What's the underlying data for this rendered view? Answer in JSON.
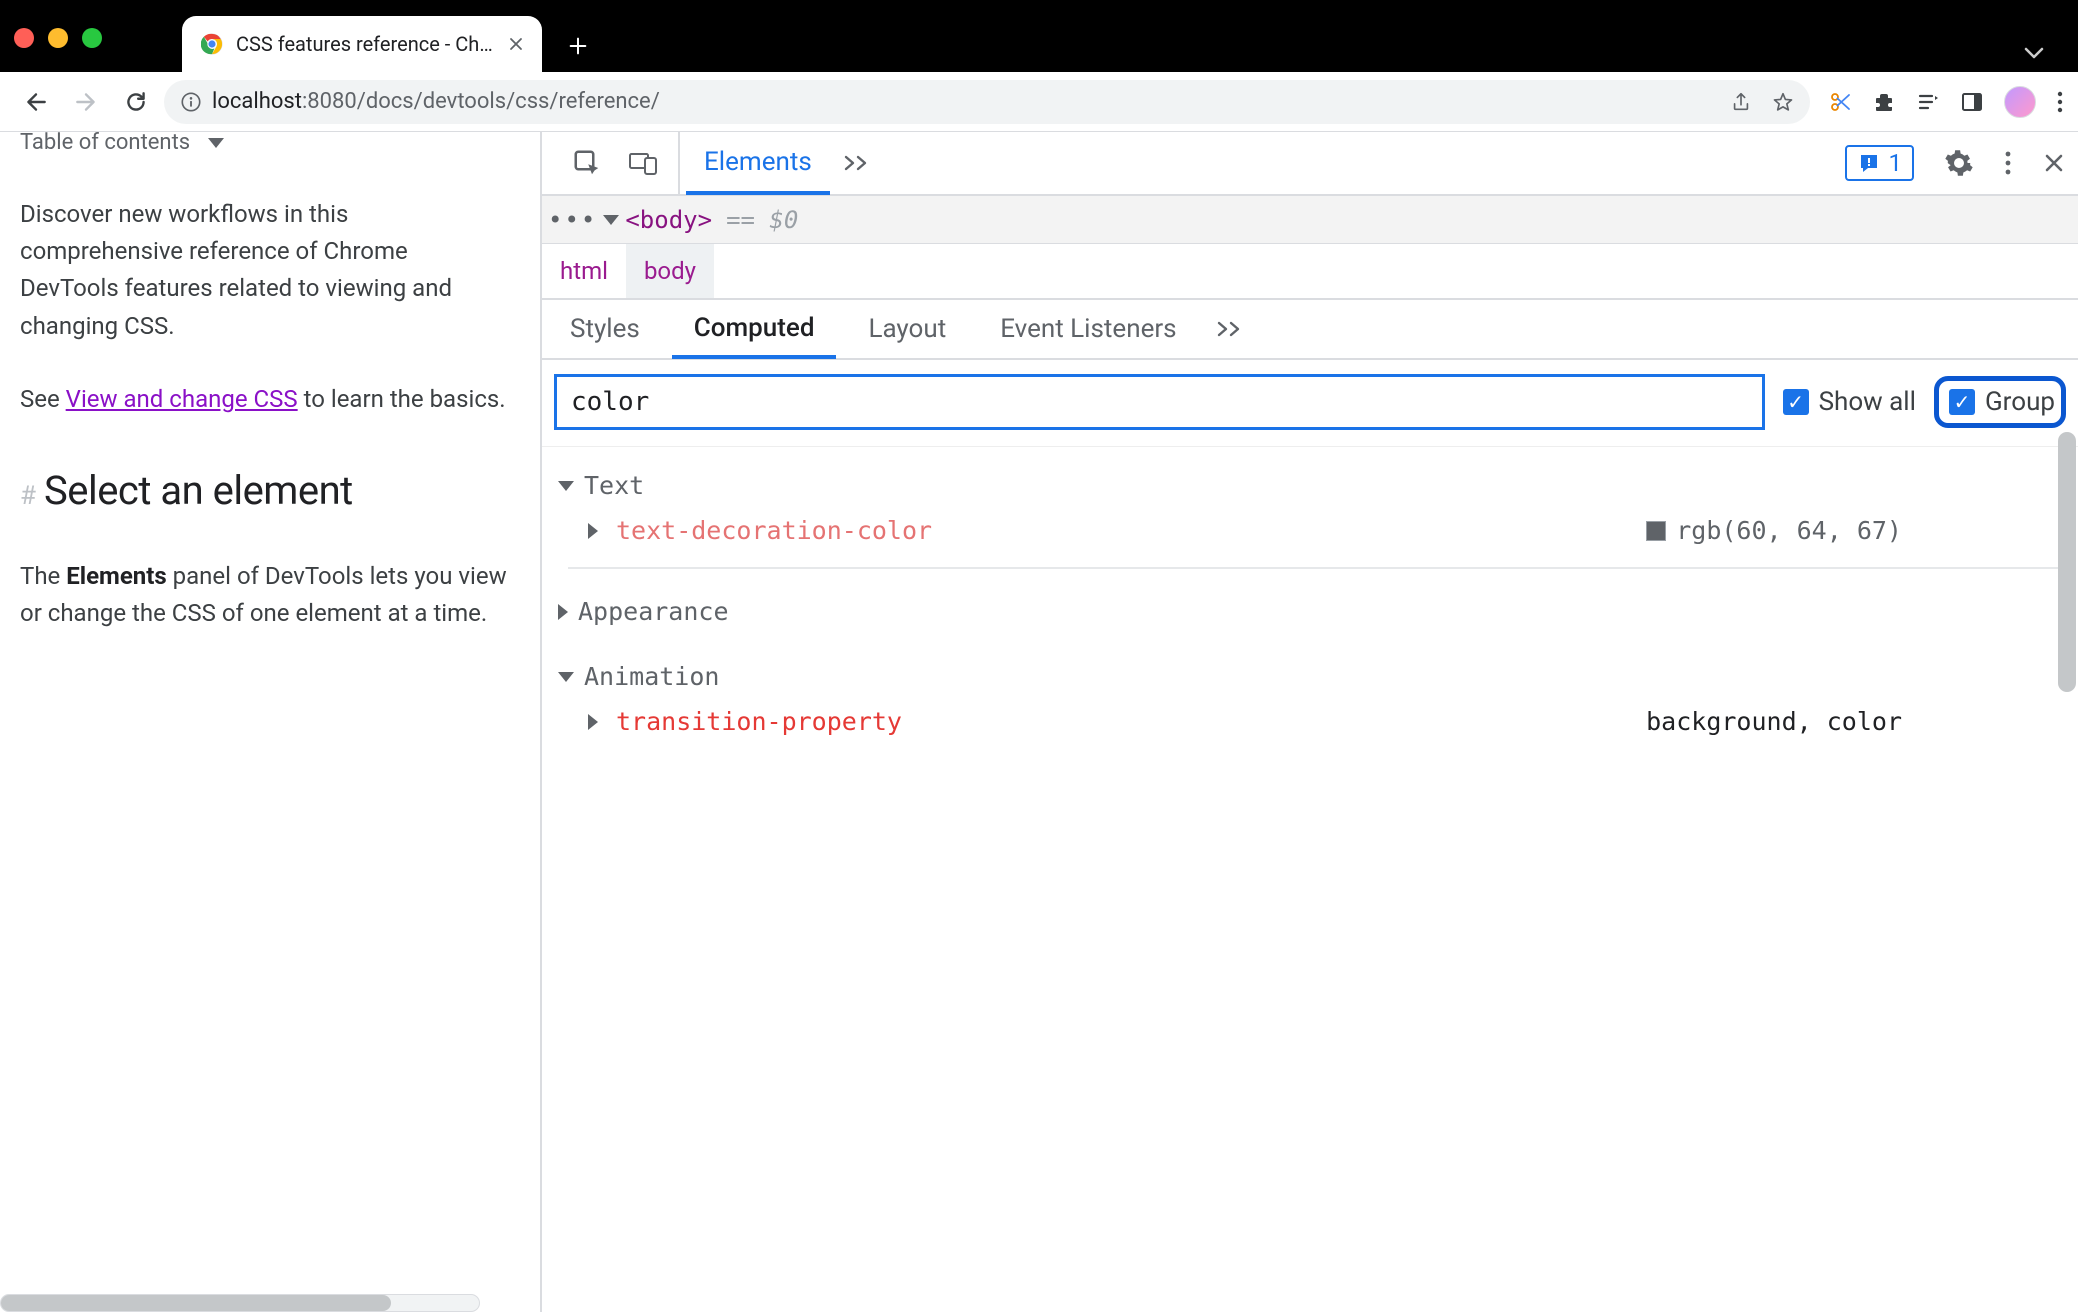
{
  "chrome": {
    "tab_title": "CSS features reference - Chrom",
    "url_host": "localhost",
    "url_port": ":8080",
    "url_path": "/docs/devtools/css/reference/"
  },
  "page": {
    "toc_label": "Table of contents",
    "intro_text": "Discover new workflows in this comprehensive reference of Chrome DevTools features related to viewing and changing CSS.",
    "see_prefix": "See ",
    "see_link": "View and change CSS",
    "see_suffix": " to learn the basics.",
    "hash": "#",
    "h2": "Select an element",
    "p2_prefix": "The ",
    "p2_bold": "Elements",
    "p2_suffix": " panel of DevTools lets you view or change the CSS of one element at a time."
  },
  "devtools": {
    "top_tab_active": "Elements",
    "issues_count": "1",
    "dom_tag": "<body>",
    "dom_meta": "== $0",
    "crumbs": [
      "html",
      "body"
    ],
    "subtabs": [
      "Styles",
      "Computed",
      "Layout",
      "Event Listeners"
    ],
    "filter_value": "color",
    "show_all_label": "Show all",
    "group_label": "Group",
    "groups": {
      "text": {
        "name": "Text",
        "prop": "text-decoration-color",
        "value": "rgb(60, 64, 67)"
      },
      "appearance": {
        "name": "Appearance"
      },
      "animation": {
        "name": "Animation",
        "prop": "transition-property",
        "value": "background, color"
      }
    }
  }
}
